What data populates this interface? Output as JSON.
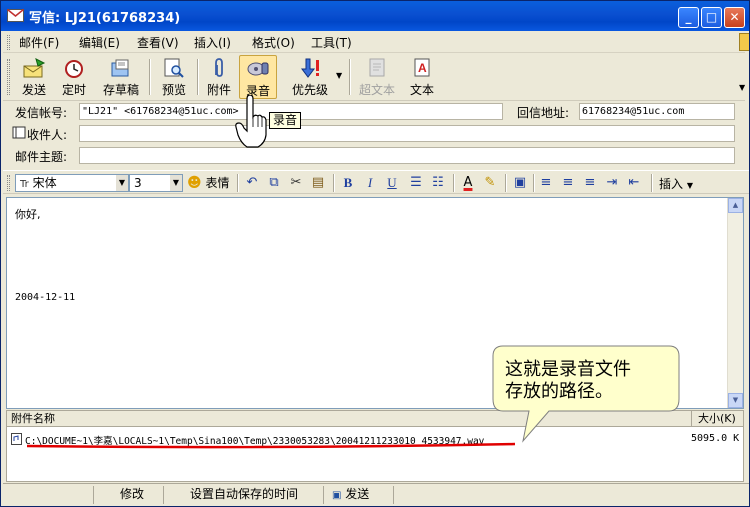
{
  "window": {
    "title": "写信: LJ21(61768234)",
    "minimize_glyph": "_",
    "maximize_glyph": "□",
    "close_glyph": "✕"
  },
  "menu": {
    "items": [
      "邮件(F)",
      "编辑(E)",
      "查看(V)",
      "插入(I)",
      "格式(O)",
      "工具(T)"
    ]
  },
  "toolbar": {
    "buttons": [
      {
        "label": "发送",
        "icon": "send-icon"
      },
      {
        "label": "定时",
        "icon": "timer-icon"
      },
      {
        "label": "存草稿",
        "icon": "save-draft-icon"
      },
      {
        "label": "预览",
        "icon": "preview-icon"
      },
      {
        "label": "附件",
        "icon": "paperclip-icon"
      },
      {
        "label": "录音",
        "icon": "record-icon"
      },
      {
        "label": "优先级",
        "icon": "priority-icon"
      },
      {
        "label": "超文本",
        "icon": "hypertext-icon"
      },
      {
        "label": "文本",
        "icon": "text-icon"
      }
    ]
  },
  "tooltip": "录音",
  "fields": {
    "from_label": "发信帐号:",
    "from_value": "\"LJ21\" <61768234@51uc.com>",
    "reply_label": "回信地址:",
    "reply_value": "61768234@51uc.com",
    "to_label": "收件人:",
    "to_value": "",
    "subject_label": "邮件主题:",
    "subject_value": ""
  },
  "format": {
    "font": "宋体",
    "size": "3",
    "emoticon_label": "表情",
    "insert_label": "插入"
  },
  "body": {
    "greeting": "你好,",
    "date": "2004-12-11"
  },
  "attachments": {
    "name_header": "附件名称",
    "size_header": "大小(K)",
    "items": [
      {
        "path": "C:\\DOCUME~1\\李嘉\\LOCALS~1\\Temp\\Sina100\\Temp\\2330053283\\20041211233010 4533947.wav",
        "size": "5095.0 K"
      }
    ]
  },
  "callout": {
    "line1": "这就是录音文件",
    "line2": "存放的路径。"
  },
  "status": {
    "modify": "修改",
    "autosave": "设置自动保存的时间",
    "send": "发送"
  },
  "colors": {
    "titlebar": "#0a4fd0",
    "underline": "#e00000",
    "callout_fill": "#ffffcc"
  }
}
